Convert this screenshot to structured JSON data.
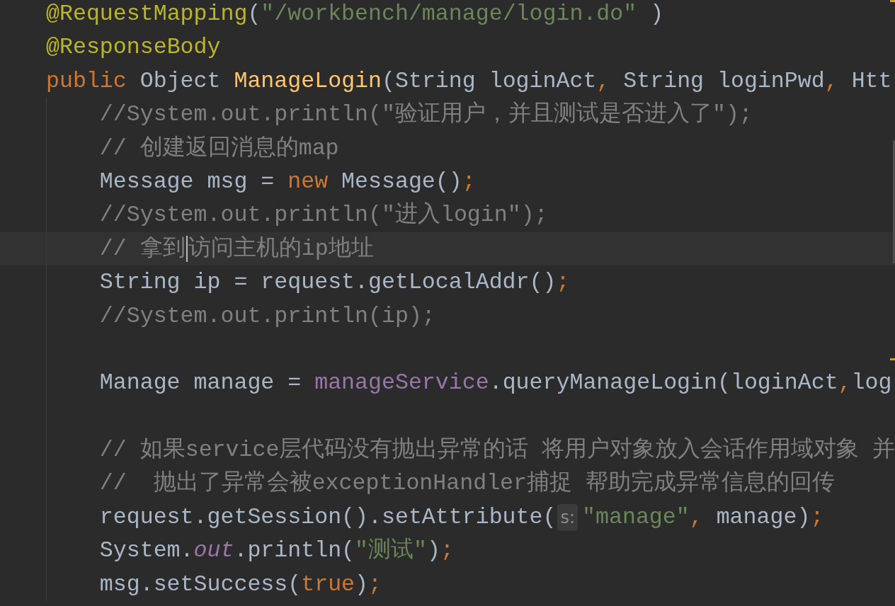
{
  "editor": {
    "lines": [
      {
        "kind": "code",
        "tokens": [
          {
            "kind": "annotation",
            "text": "@RequestMapping"
          },
          {
            "kind": "plain",
            "text": "("
          },
          {
            "kind": "string",
            "text": "\"/workbench/manage/login.do\""
          },
          {
            "kind": "plain",
            "text": " )"
          }
        ]
      },
      {
        "kind": "code",
        "tokens": [
          {
            "kind": "annotation",
            "text": "@ResponseBody"
          }
        ]
      },
      {
        "kind": "code",
        "tokens": [
          {
            "kind": "keyword",
            "text": "public"
          },
          {
            "kind": "plain",
            "text": " Object "
          },
          {
            "kind": "method",
            "text": "ManageLogin"
          },
          {
            "kind": "plain",
            "text": "(String loginAct"
          },
          {
            "kind": "separator",
            "text": ","
          },
          {
            "kind": "plain",
            "text": " String loginPwd"
          },
          {
            "kind": "separator",
            "text": ","
          },
          {
            "kind": "plain",
            "text": " Htt"
          }
        ],
        "children": [
          {
            "kind": "code",
            "tokens": [
              {
                "kind": "comment",
                "text": "//System.out.println(\"验证用户，并且测试是否进入了\");"
              }
            ]
          },
          {
            "kind": "code",
            "tokens": [
              {
                "kind": "comment",
                "text": "// 创建返回消息的map"
              }
            ]
          },
          {
            "kind": "code",
            "tokens": [
              {
                "kind": "plain",
                "text": "Message msg = "
              },
              {
                "kind": "keyword",
                "text": "new"
              },
              {
                "kind": "plain",
                "text": " Message()"
              },
              {
                "kind": "separator",
                "text": ";"
              }
            ]
          },
          {
            "kind": "code",
            "tokens": [
              {
                "kind": "comment",
                "text": "//System.out.println(\"进入login\");"
              }
            ]
          },
          {
            "kind": "code",
            "tokens": [
              {
                "kind": "comment",
                "text": "// 拿到"
              },
              {
                "kind": "caret"
              },
              {
                "kind": "comment",
                "text": "访问主机的ip地址"
              }
            ]
          },
          {
            "kind": "code",
            "tokens": [
              {
                "kind": "plain",
                "text": "String ip = request.getLocalAddr()"
              },
              {
                "kind": "separator",
                "text": ";"
              }
            ]
          },
          {
            "kind": "code",
            "tokens": [
              {
                "kind": "comment",
                "text": "//System.out.println(ip);"
              }
            ]
          },
          {
            "kind": "blank"
          },
          {
            "kind": "code",
            "tokens": [
              {
                "kind": "plain",
                "text": "Manage manage = "
              },
              {
                "kind": "field",
                "text": "manageService"
              },
              {
                "kind": "plain",
                "text": ".queryManageLogin(loginAct"
              },
              {
                "kind": "separator",
                "text": ","
              },
              {
                "kind": "plain",
                "text": "log"
              }
            ]
          },
          {
            "kind": "blank"
          },
          {
            "kind": "code",
            "tokens": [
              {
                "kind": "comment",
                "text": "// 如果service层代码没有抛出异常的话 将用户对象放入会话作用域对象 并"
              }
            ]
          },
          {
            "kind": "code",
            "tokens": [
              {
                "kind": "comment",
                "text": "//  抛出了异常会被exceptionHandler捕捉 帮助完成异常信息的回传"
              }
            ]
          },
          {
            "kind": "code",
            "tokens": [
              {
                "kind": "plain",
                "text": "request.getSession().setAttribute("
              },
              {
                "kind": "hint",
                "text": "s:"
              },
              {
                "kind": "string",
                "text": "\"manage\""
              },
              {
                "kind": "separator",
                "text": ","
              },
              {
                "kind": "plain",
                "text": " manage)"
              },
              {
                "kind": "separator",
                "text": ";"
              }
            ]
          },
          {
            "kind": "code",
            "tokens": [
              {
                "kind": "plain",
                "text": "System."
              },
              {
                "kind": "static_field",
                "text": "out"
              },
              {
                "kind": "plain",
                "text": ".println("
              },
              {
                "kind": "string",
                "text": "\"测试\""
              },
              {
                "kind": "plain",
                "text": ")"
              },
              {
                "kind": "separator",
                "text": ";"
              }
            ]
          },
          {
            "kind": "code",
            "tokens": [
              {
                "kind": "plain",
                "text": "msg.setSuccess("
              },
              {
                "kind": "keyword",
                "text": "true"
              },
              {
                "kind": "plain",
                "text": ")"
              },
              {
                "kind": "separator",
                "text": ";"
              }
            ]
          }
        ]
      }
    ]
  }
}
